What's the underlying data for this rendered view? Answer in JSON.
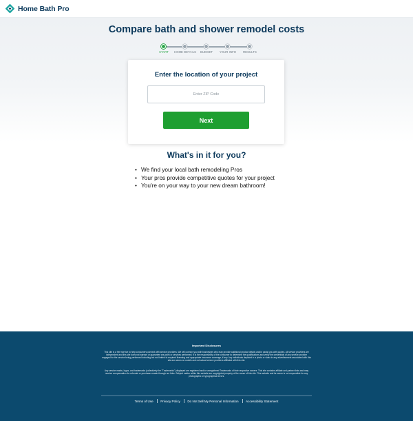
{
  "brand": {
    "name": "Home Bath Pro",
    "logo_colors": [
      "#1aa3a0",
      "#0d3a5c"
    ]
  },
  "page": {
    "title": "Compare bath and shower remodel costs"
  },
  "progress": {
    "steps": [
      {
        "label": "START",
        "active": true
      },
      {
        "label": "HOME DETAILS",
        "active": false
      },
      {
        "label": "BUDGET",
        "active": false
      },
      {
        "label": "YOUR INFO",
        "active": false
      },
      {
        "label": "RESULTS",
        "active": false
      }
    ],
    "active_color": "#2ca84a"
  },
  "form": {
    "heading": "Enter the location of your project",
    "zip_placeholder": "Enter ZIP Code",
    "zip_value": "",
    "next_label": "Next",
    "button_color": "#1e9f31"
  },
  "benefits": {
    "heading": "What's in it for you?",
    "items": [
      "We find your local bath remodeling Pros",
      "Your pros provide competitive quotes for your project",
      "You're on your way to your new dream bathroom!"
    ]
  },
  "footer": {
    "background": "#0c4a6e",
    "disclosures_title": "Important Disclosures",
    "disclosure_1": "This site is a free service to help consumers connect with service providers. We will connect you with businesses who may provide additional product details and/or assist you with quotes. All service providers are independent and this site does not warrant or guarantee any work or services performed. It is the responsibility of the consumer to determine the qualifications and verify the credentials of any service provider engaged for the service being performed including but not limited to required licensing and appropriate insurance coverage, if any. Any individuals depicted in a photo or video in any advertisement associated with this site are actors or models and not actual service providers affiliated with this site.",
    "disclosure_2": "Any service marks, logos, and trademarks (collectively the \"Trademarks\") displayed are registered and/or unregistered Trademarks of their respective owners. This site contains affiliate and partner links and may receive compensation for referrals or purchases made through our links. Subject matter within this website are copyrighted property of the owner of this site. This website and its owner is not responsible for any photographic or typographical errors.",
    "links": [
      "Terms of Use",
      "Privacy Policy",
      "Do Not Sell My Personal Information",
      "Accessibility Statement"
    ]
  }
}
